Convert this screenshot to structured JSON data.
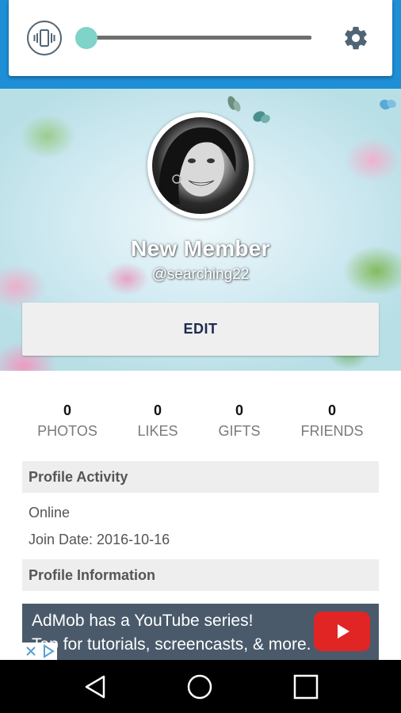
{
  "volume_panel": {
    "vibrate_icon": "vibrate-icon",
    "settings_icon": "gear-icon",
    "slider_level": 0.0,
    "accent_color": "#7fd3c8"
  },
  "profile": {
    "name": "New Member",
    "handle": "@searching22",
    "edit_label": "EDIT"
  },
  "stats": [
    {
      "count": "0",
      "label": "PHOTOS"
    },
    {
      "count": "0",
      "label": "LIKES"
    },
    {
      "count": "0",
      "label": "GIFTS"
    },
    {
      "count": "0",
      "label": "FRIENDS"
    }
  ],
  "activity": {
    "header": "Profile Activity",
    "status": "Online",
    "join_date": "Join Date: 2016-10-16"
  },
  "information": {
    "header": "Profile Information"
  },
  "ad": {
    "line1": "AdMob has a YouTube series!",
    "line2": "Tap for tutorials, screencasts, & more.",
    "play_icon": "play-icon",
    "adchoices_icon": "adchoices-icon"
  },
  "navbar": {
    "back_icon": "back-icon",
    "home_icon": "home-icon",
    "recents_icon": "recents-icon"
  },
  "colors": {
    "top_bar": "#1e8fd6",
    "edit_text": "#1d2b4f",
    "ad_background": "#4a5a6b",
    "youtube_red": "#e12525"
  }
}
